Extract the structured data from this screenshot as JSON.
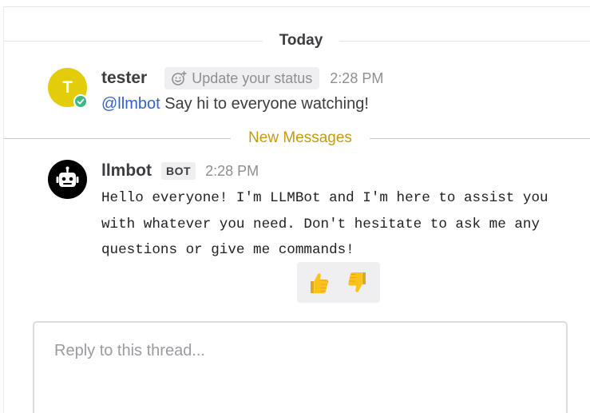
{
  "date_separator": {
    "label": "Today"
  },
  "posts": [
    {
      "username": "tester",
      "avatar_initial": "T",
      "avatar_color": "#e3cc0a",
      "status_dot_color": "#3db887",
      "status_prompt": "Update your status",
      "status_icon": "smile-plus-icon",
      "time": "2:28 PM",
      "mention": "@llmbot",
      "message": " Say hi to everyone watching!"
    },
    {
      "username": "llmbot",
      "avatar_icon": "robot-icon",
      "avatar_color": "#000000",
      "badge": "BOT",
      "time": "2:28 PM",
      "message_lines": [
        "Hello everyone! I'm LLMBot and I'm here to assist you",
        "with whatever you need. Don't hesitate to ask me any",
        "questions or give me commands!"
      ],
      "reactions": [
        {
          "icon": "thumbs-up-icon"
        },
        {
          "icon": "thumbs-down-icon"
        }
      ]
    }
  ],
  "new_messages_separator": {
    "label": "New Messages",
    "color": "#c79a0d"
  },
  "reply": {
    "placeholder": "Reply to this thread..."
  },
  "colors": {
    "mention": "#2f62d4",
    "text": "#3d3c40",
    "muted": "#8e8e93"
  }
}
